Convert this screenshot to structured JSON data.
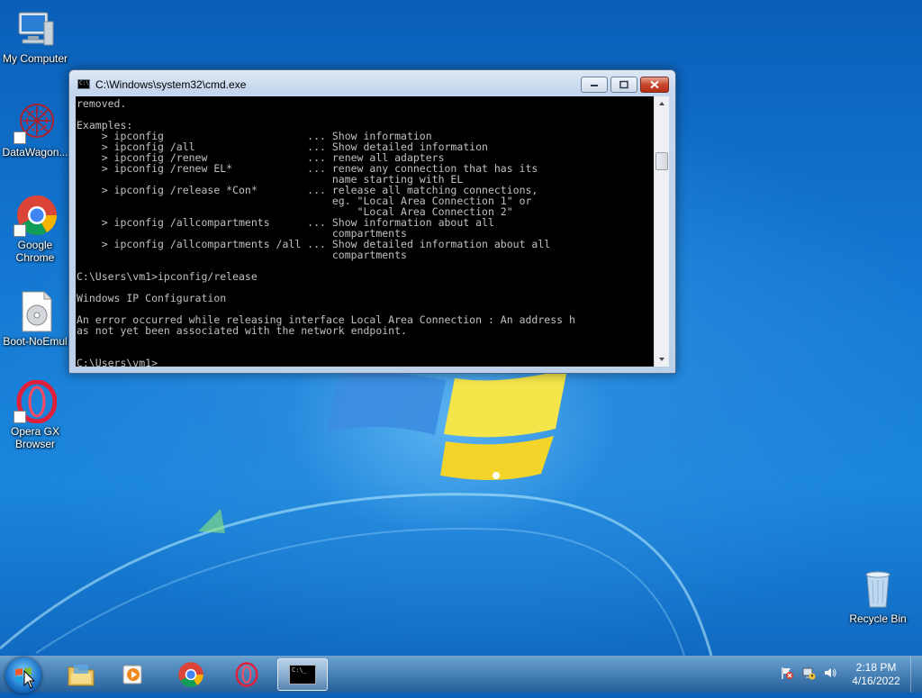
{
  "desktop": {
    "icons": [
      {
        "label": "My Computer"
      },
      {
        "label": "DataWagon..."
      },
      {
        "label": "Google\nChrome"
      },
      {
        "label": "Boot-NoEmul"
      },
      {
        "label": "Opera GX\nBrowser"
      },
      {
        "label": "Recycle Bin"
      }
    ]
  },
  "window": {
    "title": "C:\\Windows\\system32\\cmd.exe",
    "icon_text": "C:\\",
    "console_lines": [
      "removed.",
      "",
      "Examples:",
      "    > ipconfig                       ... Show information",
      "    > ipconfig /all                  ... Show detailed information",
      "    > ipconfig /renew                ... renew all adapters",
      "    > ipconfig /renew EL*            ... renew any connection that has its",
      "                                         name starting with EL",
      "    > ipconfig /release *Con*        ... release all matching connections,",
      "                                         eg. \"Local Area Connection 1\" or",
      "                                             \"Local Area Connection 2\"",
      "    > ipconfig /allcompartments      ... Show information about all",
      "                                         compartments",
      "    > ipconfig /allcompartments /all ... Show detailed information about all",
      "                                         compartments",
      "",
      "C:\\Users\\vm1>ipconfig/release",
      "",
      "Windows IP Configuration",
      "",
      "An error occurred while releasing interface Local Area Connection : An address h",
      "as not yet been associated with the network endpoint.",
      "",
      "",
      "C:\\Users\\vm1>"
    ]
  },
  "taskbar": {
    "clock_time": "2:18 PM",
    "clock_date": "4/16/2022",
    "cmd_icon_text": "C:\\_"
  },
  "colors": {
    "console_bg": "#000000",
    "console_fg": "#c0c0c0",
    "desktop_blue": "#1478d2"
  }
}
